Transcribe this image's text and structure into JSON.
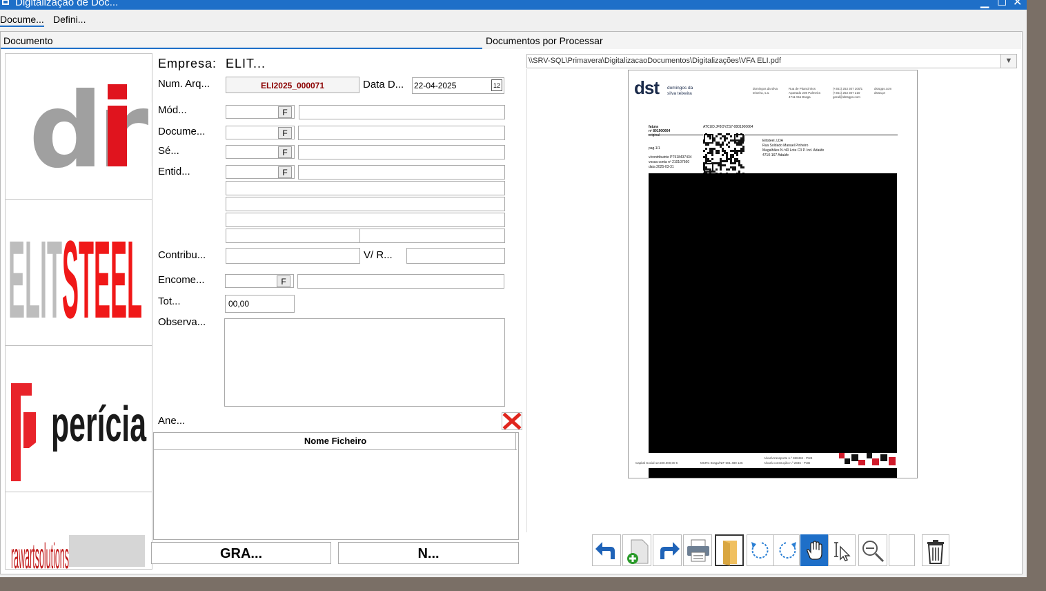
{
  "window": {
    "title": "Digitalização de Doc...",
    "minimize": "▁",
    "maximize": "☐",
    "close": "✕"
  },
  "menu": {
    "items": [
      "Docume...",
      "Defini..."
    ]
  },
  "headers": {
    "left": "Documento",
    "right": "Documentos por Processar"
  },
  "logos": {
    "logo1": "dri",
    "logo2_a": "ELIT",
    "logo2_b": "STEEL",
    "logo3": "perícia",
    "logo4": "rawartsolutions"
  },
  "form": {
    "empresa_label": "Empresa:",
    "empresa_value": "ELIT...",
    "num_arq_label": "Num. Arq...",
    "num_arq_value": "ELI2025_000071",
    "data_label": "Data D...",
    "data_value": "22-04-2025",
    "calendar_day": "12",
    "modulo_label": "Mód...",
    "documento_label": "Docume...",
    "serie_label": "Sé...",
    "entidade_label": "Entid...",
    "contribuinte_label": "Contribu...",
    "vref_label": "V/ R...",
    "encomenda_label": "Encome...",
    "total_label": "Tot...",
    "total_value": "00,00",
    "observacoes_label": "Observa...",
    "anexos_label": "Ane...",
    "f_button": "F"
  },
  "attachments": {
    "column_header": "Nome Ficheiro"
  },
  "buttons": {
    "save": "GRA...",
    "new": "N..."
  },
  "viewer": {
    "file_path": "\\\\SRV-SQL\\Primavera\\DigitalizacaoDocumentos\\Digitalizações\\VFA ELI.pdf",
    "dropdown_arrow": "▼"
  },
  "invoice": {
    "brand": "dst",
    "brand_sub1": "domingos da",
    "brand_sub2": "silva teixeira",
    "col1_1": "domingos da silva",
    "col1_2": "teixeira, s.a.",
    "col2_1": "Rua de Pitancinhos",
    "col2_2": "Apartado 208 Palmeira",
    "col2_3": "4711-911 Braga",
    "col3_1": "(+351) 253 307 200/1",
    "col3_2": "(+351) 253 307 210",
    "col3_3": "geral@dstsgps.com",
    "col4_1": "dstsgps.com",
    "col4_2": "dstsa.pt",
    "doc_type": "fatura",
    "doc_num": "nº 801900664",
    "doc_orig": "original",
    "atcud": "ATCUD:JF8OYZS7-0801900664",
    "page": "pag.1/1",
    "contrib": "v/contribuinte PT518437434",
    "account": "vossa conta nº 210107660",
    "date": "data 2025-03-31",
    "client_1": "Elitsteel, LDA",
    "client_2": "Rua Soldado Manuel Pinheiro",
    "client_3": "Magalhães N.º40 Lote C3 P. Ind. Adaúfe",
    "client_4": "4710-167 Adaúfe",
    "footer_1": "Capital Social 12.500.000,00 €",
    "footer_2": "MCRC Braga/NIF 501 489 126",
    "footer_3": "Alvará transporte n.º 868484 - PUB",
    "footer_4": "Alvará construção n.º 2846 - PUB"
  },
  "toolbar": [
    "undo-arrow-icon",
    "add-page-icon",
    "redo-arrow-icon",
    "print-icon",
    "folder-icon",
    "rotate-left-icon",
    "rotate-right-icon",
    "hand-pan-icon",
    "text-select-icon",
    "zoom-out-icon",
    "blank",
    "trash-icon"
  ]
}
